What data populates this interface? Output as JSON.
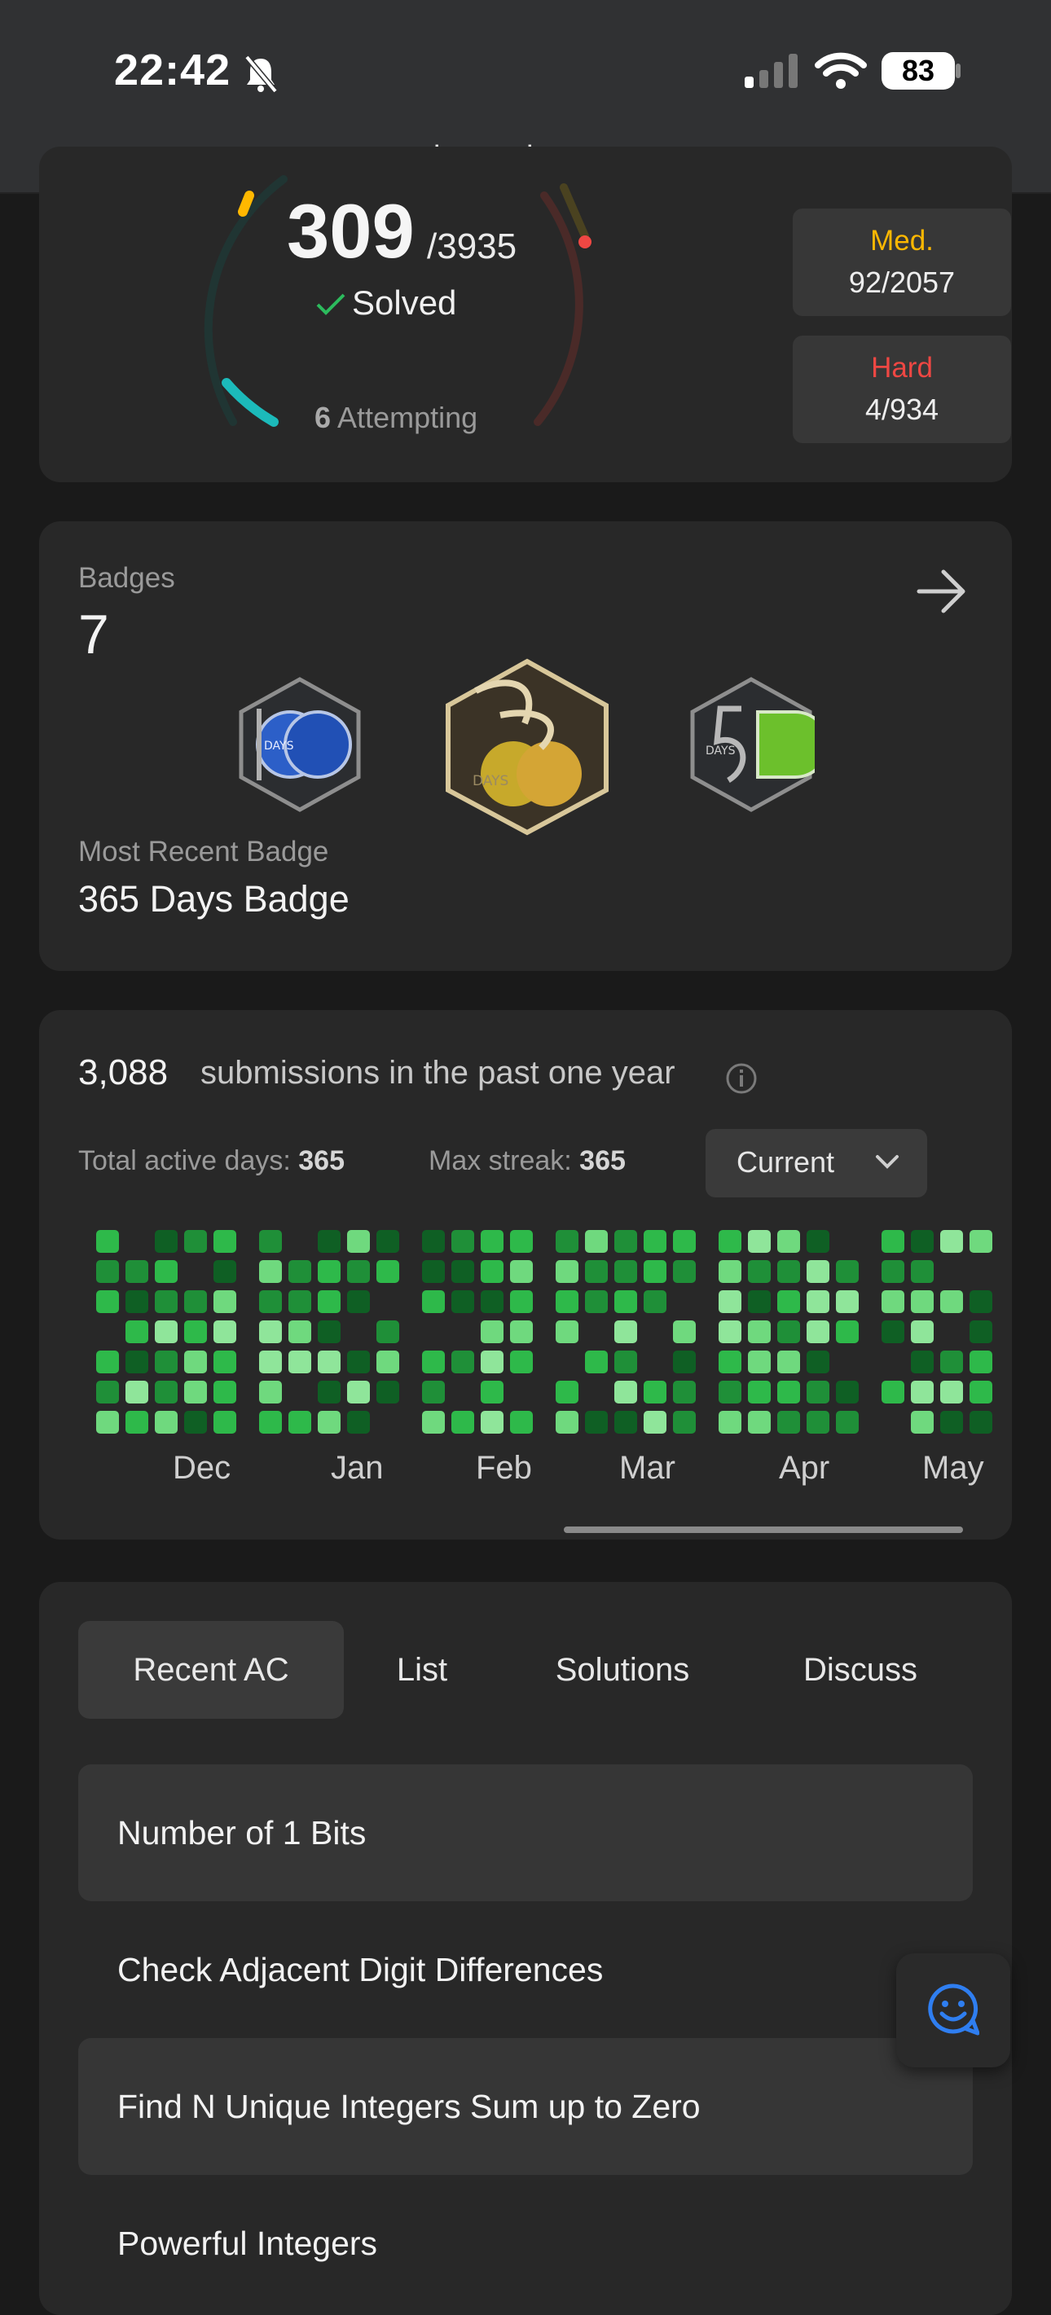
{
  "status_bar": {
    "time": "22:42",
    "battery": "83"
  },
  "browser": {
    "url": "leetcode.com"
  },
  "progress": {
    "solved": "309",
    "total": "/3935",
    "solved_label": "Solved",
    "attempting_count": "6",
    "attempting_label": "Attempting",
    "medium": {
      "label": "Med.",
      "value": "92/2057",
      "color": "#ffb800"
    },
    "hard": {
      "label": "Hard",
      "value": "4/934",
      "color": "#ef4743"
    }
  },
  "badges": {
    "label": "Badges",
    "count": "7",
    "most_recent_label": "Most Recent Badge",
    "most_recent_name": "365 Days Badge",
    "icons": [
      "100-days-badge",
      "365-days-badge",
      "50-days-badge"
    ],
    "badge_text": {
      "b100": "DAYS",
      "b365": "DAYS",
      "b50": "DAYS"
    }
  },
  "submissions": {
    "count": "3,088",
    "text": "submissions in the past one year",
    "active_days_label": "Total active days:",
    "active_days": "365",
    "max_streak_label": "Max streak:",
    "max_streak": "365",
    "period": "Current",
    "months": [
      "Dec",
      "Jan",
      "Feb",
      "Mar",
      "Apr",
      "May"
    ]
  },
  "tabs": [
    "Recent AC",
    "List",
    "Solutions",
    "Discuss"
  ],
  "recent_ac": [
    "Number of 1 Bits",
    "Check Adjacent Digit Differences",
    "Find N Unique Integers Sum up to Zero",
    "Powerful Integers"
  ],
  "colors": {
    "easy": "#1cbaba",
    "medium": "#ffb800",
    "hard": "#ef4743",
    "accent": "#2cbb5d",
    "chat": "#2f7ef0"
  }
}
